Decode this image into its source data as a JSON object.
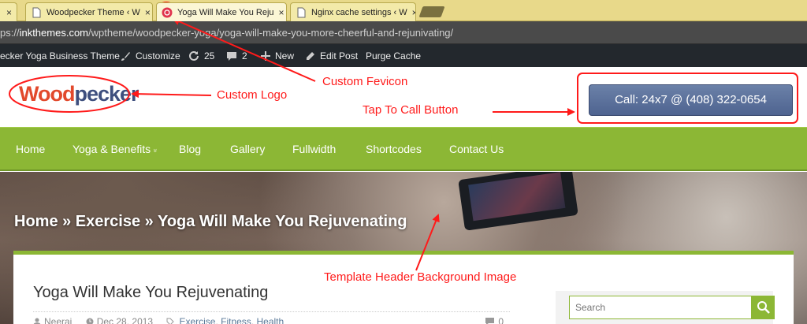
{
  "browser": {
    "tabs": [
      {
        "label": "Woodpecker Theme ‹ W"
      },
      {
        "label": "Yoga Will Make You Reju"
      },
      {
        "label": "Nginx cache settings ‹ W"
      }
    ],
    "close_glyph": "×",
    "url_prefix": "ps://",
    "url_host": "inkthemes.com",
    "url_path": "/wptheme/woodpecker-yoga/yoga-will-make-you-more-cheerful-and-rejunivating/"
  },
  "adminbar": {
    "site_name": "ecker Yoga Business Theme",
    "customize": "Customize",
    "updates_count": "25",
    "comments_count": "2",
    "new": "New",
    "edit_post": "Edit Post",
    "purge_cache": "Purge Cache"
  },
  "header": {
    "logo_part1": "Wood",
    "logo_part2": "pecker",
    "call_button": "Call: 24x7 @ (408) 322-0654"
  },
  "nav": {
    "items": [
      "Home",
      "Yoga & Benefits",
      "Blog",
      "Gallery",
      "Fullwidth",
      "Shortcodes",
      "Contact Us"
    ],
    "dropdown_glyph": "»"
  },
  "hero": {
    "breadcrumb": "Home » Exercise » Yoga Will Make You Rejuvenating"
  },
  "post": {
    "title": "Yoga Will Make You Rejuvenating",
    "author": "Neeraj",
    "date": "Dec 28, 2013",
    "categories": [
      "Exercise",
      "Fitness",
      "Health"
    ],
    "comments": "0"
  },
  "sidebar": {
    "search_placeholder": "Search"
  },
  "annotations": {
    "custom_fevicon": "Custom Fevicon",
    "custom_logo": "Custom Logo",
    "tap_to_call": "Tap To Call Button",
    "header_bg": "Template Header Background Image"
  },
  "colors": {
    "accent_green": "#8cb735",
    "annotation_red": "#ff1a1a",
    "adminbar_bg": "#23282d",
    "call_button_blue": "#5a6f9a"
  },
  "icons": [
    "close-icon",
    "favicon-icon",
    "brush-icon",
    "refresh-icon",
    "comment-icon",
    "plus-icon",
    "pencil-icon",
    "user-icon",
    "clock-icon",
    "tag-icon",
    "search-icon"
  ]
}
